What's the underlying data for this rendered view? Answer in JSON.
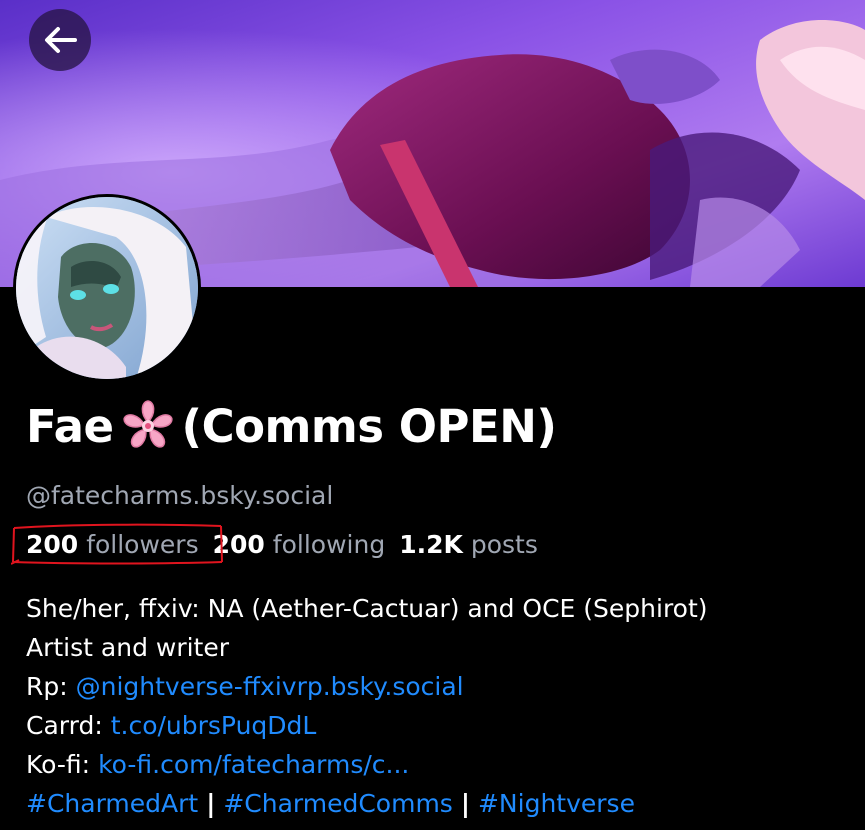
{
  "header": {
    "back_button_icon": "arrow-left-icon"
  },
  "profile": {
    "name_before_emoji": "Fae",
    "emoji": "cherry-blossom-icon",
    "name_after_emoji": "(Comms OPEN)",
    "handle": "@fatecharms.bsky.social",
    "stats": {
      "followers_count": "200",
      "followers_label": "followers",
      "following_count": "200",
      "following_label": "following",
      "posts_count": "1.2K",
      "posts_label": "posts"
    },
    "bio": {
      "line1": "She/her, ffxiv: NA (Aether-Cactuar) and OCE (Sephirot)",
      "line2": "Artist and writer",
      "rp_label": "Rp:",
      "rp_link": "@nightverse-ffxivrp.bsky.social",
      "carrd_label": "Carrd:",
      "carrd_link": "t.co/ubrsPuqDdL",
      "kofi_label": "Ko-fi:",
      "kofi_link": "ko-fi.com/fatecharms/c...",
      "tags": [
        "#CharmedArt",
        "#CharmedComms",
        "#Nightverse"
      ],
      "tag_separator": "|"
    }
  },
  "colors": {
    "background": "#000000",
    "link": "#208bfe",
    "secondary_text": "#a0a7b3",
    "annotation_red": "#e0141e"
  }
}
